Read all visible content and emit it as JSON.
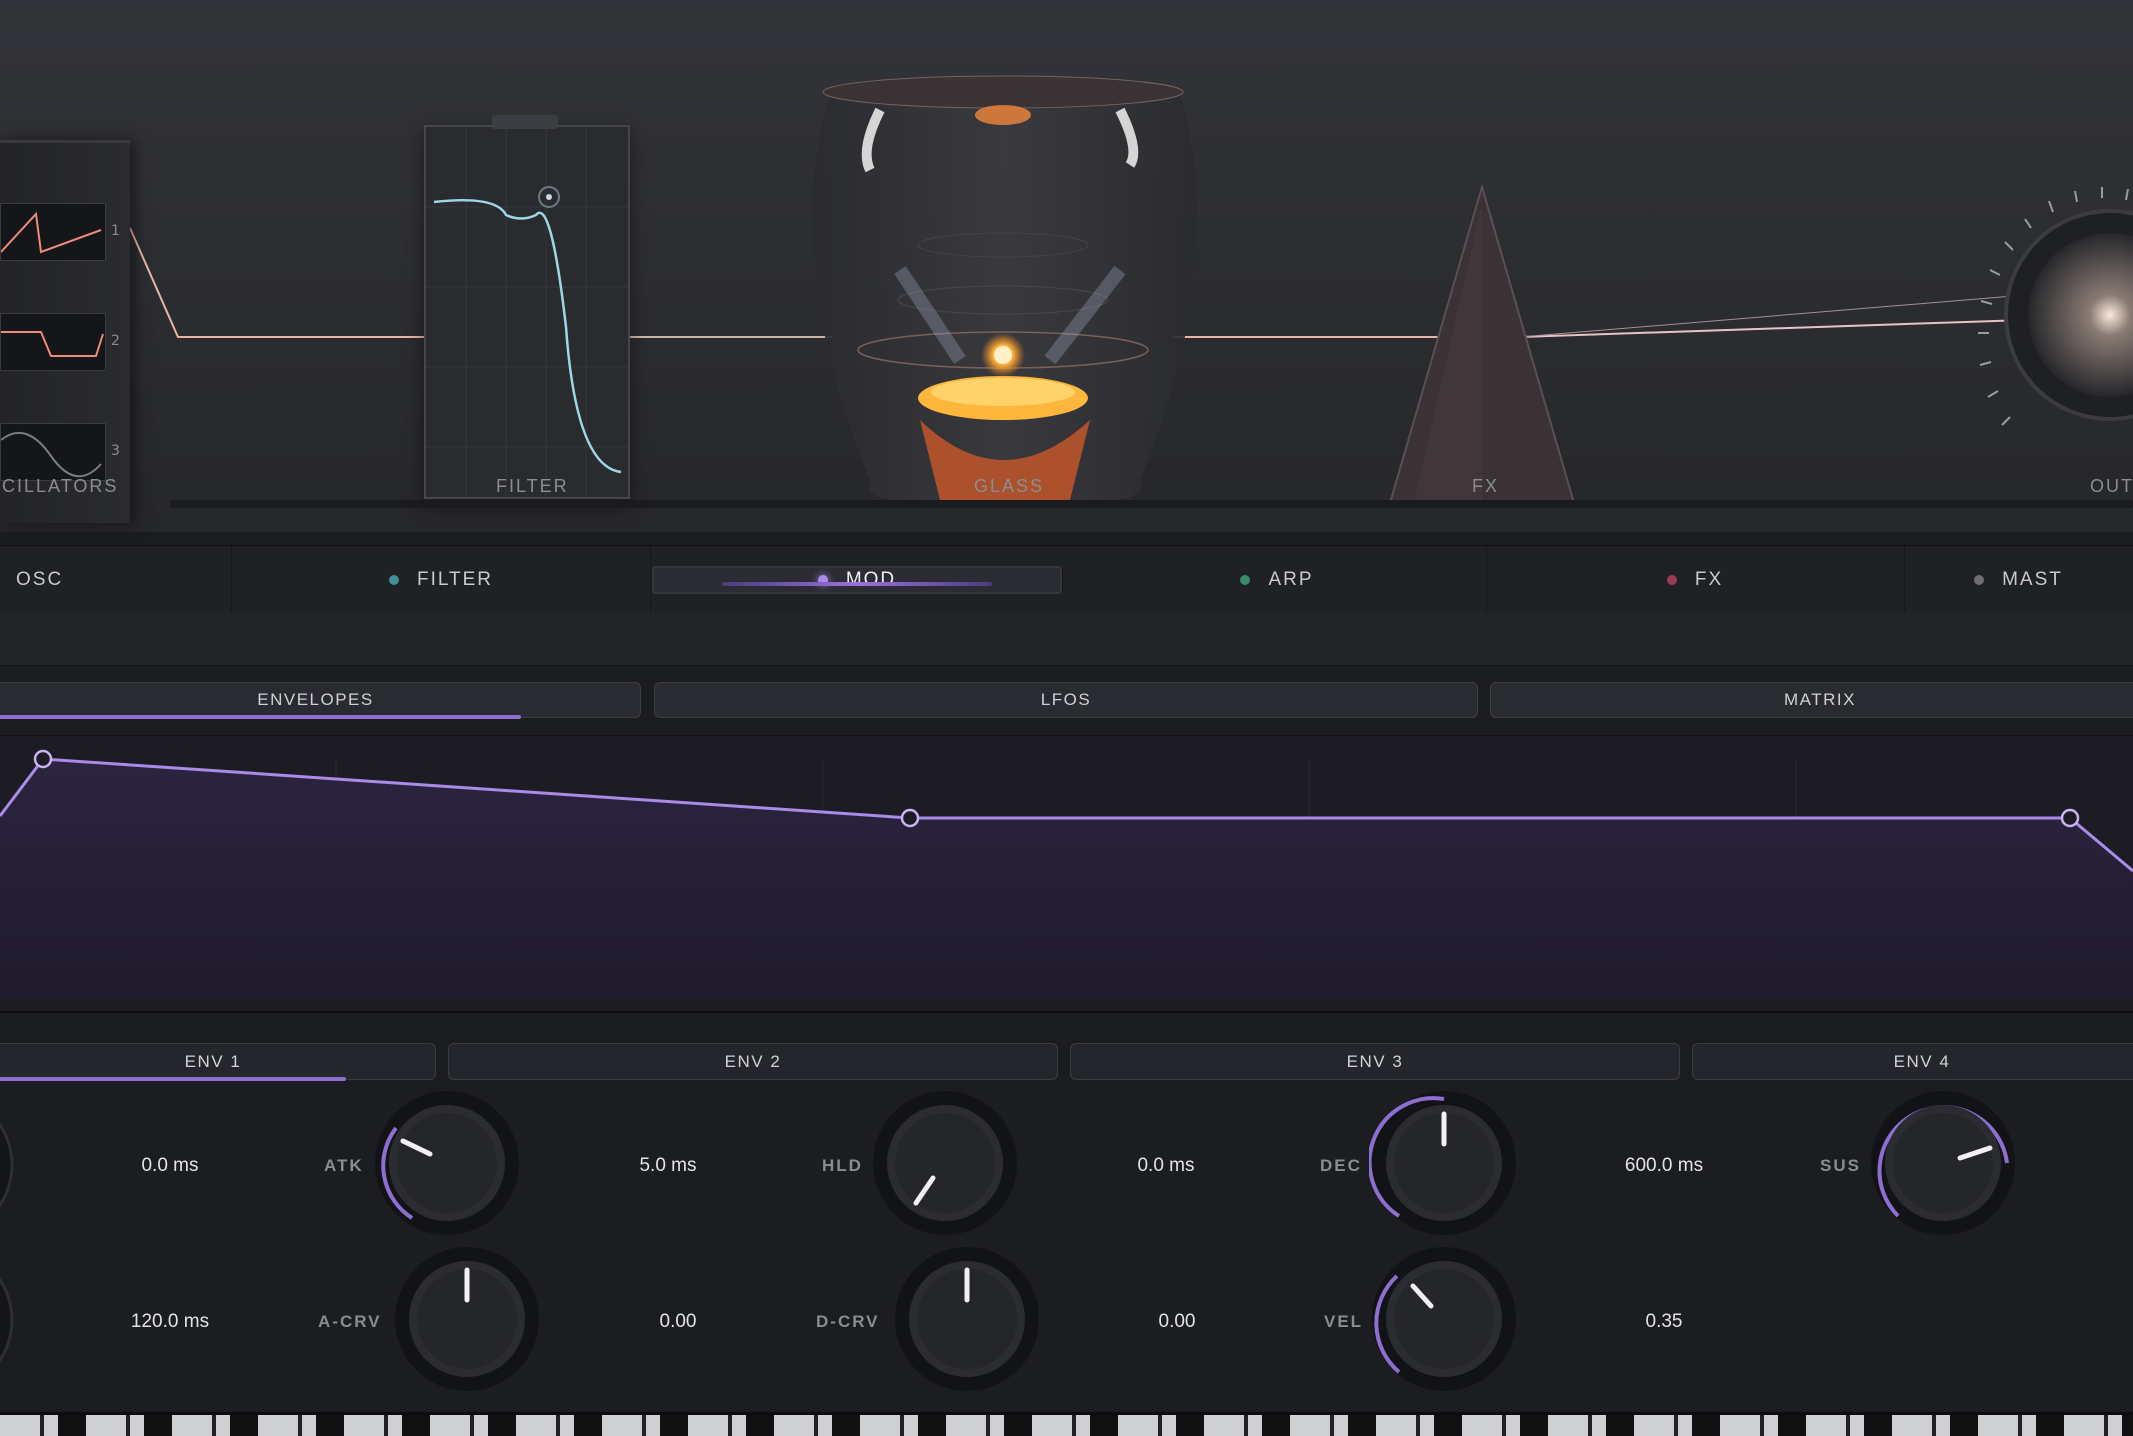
{
  "chain": {
    "oscillators_label": "CILLATORS",
    "filter_label": "FILTER",
    "glass_label": "GLASS",
    "fx_label": "FX",
    "out_label": "OUT",
    "osc_numbers": [
      "1",
      "2",
      "3"
    ]
  },
  "tabs": [
    {
      "label": "OSC",
      "dot_color": ""
    },
    {
      "label": "FILTER",
      "dot_color": "#3f8f96"
    },
    {
      "label": "MOD",
      "dot_color": "#a98be8",
      "active": true
    },
    {
      "label": "ARP",
      "dot_color": "#3a8a6a"
    },
    {
      "label": "FX",
      "dot_color": "#9a3b55"
    },
    {
      "label": "MAST",
      "dot_color": "#6d6f75"
    }
  ],
  "subtabs": [
    "ENVELOPES",
    "LFOS",
    "MATRIX"
  ],
  "env_tabs": [
    "ENV 1",
    "ENV 2",
    "ENV 3",
    "ENV 4"
  ],
  "knobs": {
    "row1": [
      {
        "label": "ATK",
        "value": "5.0 ms"
      },
      {
        "label": "HLD",
        "value": "0.0 ms"
      },
      {
        "label": "DEC",
        "value": "600.0 ms"
      },
      {
        "label": "SUS",
        "value": ""
      }
    ],
    "row1_left_value": "0.0 ms",
    "row2": [
      {
        "label": "A-CRV",
        "value": "0.00"
      },
      {
        "label": "D-CRV",
        "value": "0.00"
      },
      {
        "label": "VEL",
        "value": "0.35"
      }
    ],
    "row2_left_value": "120.0 ms"
  },
  "colors": {
    "accent": "#9a72e0",
    "envelope_line": "#a98be8",
    "filter_curve": "#9fd6e6",
    "wave": "#f08a7a"
  }
}
